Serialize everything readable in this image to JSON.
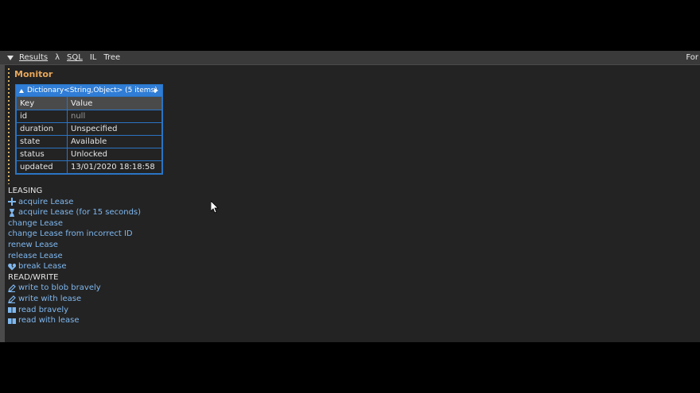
{
  "toolbar": {
    "items": [
      {
        "label": "Results",
        "underline": true
      },
      {
        "label": "λ",
        "underline": false
      },
      {
        "label": "SQL",
        "underline": true
      },
      {
        "label": "IL",
        "underline": false
      },
      {
        "label": "Tree",
        "underline": false
      }
    ],
    "right_label": "For"
  },
  "monitor": {
    "title": "Monitor",
    "dict_header": "Dictionary<String,Object> (5 items)",
    "columns": [
      "Key",
      "Value"
    ],
    "rows": [
      {
        "key": "id",
        "value": "null"
      },
      {
        "key": "duration",
        "value": "Unspecified"
      },
      {
        "key": "state",
        "value": "Available"
      },
      {
        "key": "status",
        "value": "Unlocked"
      },
      {
        "key": "updated",
        "value": "13/01/2020 18:18:58"
      }
    ]
  },
  "leasing": {
    "heading": "LEASING",
    "acquire": "acquire Lease",
    "acquire15": "acquire Lease (for 15 seconds)",
    "change": "change Lease",
    "change_incorrect": "change Lease from incorrect ID",
    "renew": "renew Lease",
    "release": "release Lease",
    "break": "break Lease"
  },
  "readwrite": {
    "heading": "READ/WRITE",
    "write_bravely": "write to blob bravely",
    "write_lease": "write with lease",
    "read_bravely": "read bravely",
    "read_lease": "read with lease"
  },
  "colors": {
    "background": "#232323",
    "link": "#7fb8f0",
    "accent_blue": "#2f7dd6",
    "monitor_title": "#e8a75a"
  }
}
